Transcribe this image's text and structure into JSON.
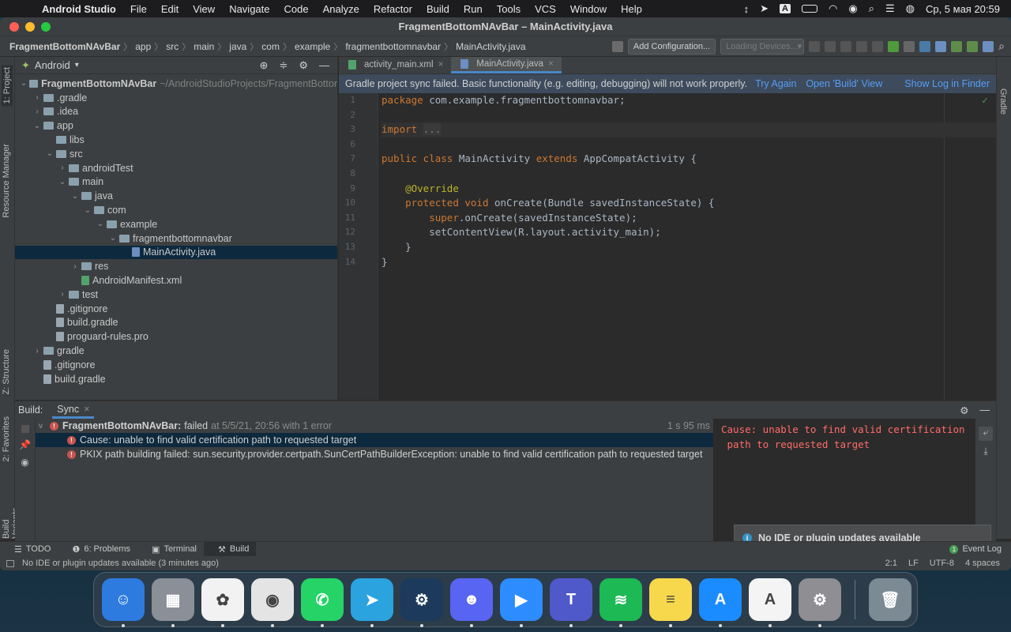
{
  "menubar": {
    "app": "Android Studio",
    "items": [
      "File",
      "Edit",
      "View",
      "Navigate",
      "Code",
      "Analyze",
      "Refactor",
      "Build",
      "Run",
      "Tools",
      "VCS",
      "Window",
      "Help"
    ],
    "datetime": "Ср, 5 мая  20:59"
  },
  "window": {
    "title": "FragmentBottomNAvBar – MainActivity.java"
  },
  "breadcrumb": [
    "FragmentBottomNAvBar",
    "app",
    "src",
    "main",
    "java",
    "com",
    "example",
    "fragmentbottomnavbar",
    "MainActivity.java"
  ],
  "toolbar": {
    "add_config": "Add Configuration...",
    "devices": "Loading Devices..."
  },
  "left_stripe": {
    "project": "1: Project",
    "resource": "Resource Manager",
    "structure": "Z: Structure",
    "favorites": "2: Favorites",
    "variants": "Build Variants"
  },
  "right_stripe": {
    "gradle": "Gradle"
  },
  "project": {
    "view": "Android",
    "tree": [
      {
        "label": "FragmentBottomNAvBar",
        "extra": "~/AndroidStudioProjects/FragmentBottor",
        "indent": 0,
        "arrow": "v",
        "icon": "folder",
        "bold": true
      },
      {
        "label": ".gradle",
        "indent": 1,
        "arrow": ">",
        "icon": "folder"
      },
      {
        "label": ".idea",
        "indent": 1,
        "arrow": ">",
        "icon": "folder"
      },
      {
        "label": "app",
        "indent": 1,
        "arrow": "v",
        "icon": "folder"
      },
      {
        "label": "libs",
        "indent": 2,
        "arrow": "",
        "icon": "folder"
      },
      {
        "label": "src",
        "indent": 2,
        "arrow": "v",
        "icon": "folder"
      },
      {
        "label": "androidTest",
        "indent": 3,
        "arrow": ">",
        "icon": "folder"
      },
      {
        "label": "main",
        "indent": 3,
        "arrow": "v",
        "icon": "folder"
      },
      {
        "label": "java",
        "indent": 4,
        "arrow": "v",
        "icon": "folder"
      },
      {
        "label": "com",
        "indent": 5,
        "arrow": "v",
        "icon": "folder"
      },
      {
        "label": "example",
        "indent": 6,
        "arrow": "v",
        "icon": "folder"
      },
      {
        "label": "fragmentbottomnavbar",
        "indent": 7,
        "arrow": "v",
        "icon": "folder"
      },
      {
        "label": "MainActivity.java",
        "indent": 8,
        "arrow": "",
        "icon": "java",
        "selected": true
      },
      {
        "label": "res",
        "indent": 4,
        "arrow": ">",
        "icon": "folder"
      },
      {
        "label": "AndroidManifest.xml",
        "indent": 4,
        "arrow": "",
        "icon": "xml"
      },
      {
        "label": "test",
        "indent": 3,
        "arrow": ">",
        "icon": "folder"
      },
      {
        "label": ".gitignore",
        "indent": 2,
        "arrow": "",
        "icon": "file"
      },
      {
        "label": "build.gradle",
        "indent": 2,
        "arrow": "",
        "icon": "file"
      },
      {
        "label": "proguard-rules.pro",
        "indent": 2,
        "arrow": "",
        "icon": "file"
      },
      {
        "label": "gradle",
        "indent": 1,
        "arrow": ">",
        "icon": "folder"
      },
      {
        "label": ".gitignore",
        "indent": 1,
        "arrow": "",
        "icon": "file"
      },
      {
        "label": "build.gradle",
        "indent": 1,
        "arrow": "",
        "icon": "file"
      }
    ]
  },
  "editor": {
    "tabs": [
      {
        "label": "activity_main.xml",
        "active": false
      },
      {
        "label": "MainActivity.java",
        "active": true
      }
    ],
    "banner": {
      "message": "Gradle project sync failed. Basic functionality (e.g. editing, debugging) will not work properly.",
      "try_again": "Try Again",
      "open_build": "Open 'Build' View",
      "show_log": "Show Log in Finder"
    },
    "line_numbers": [
      "1",
      "2",
      "3",
      "6",
      "7",
      "8",
      "9",
      "10",
      "11",
      "12",
      "13",
      "14"
    ],
    "code": [
      [
        {
          "t": "package ",
          "c": "kw"
        },
        {
          "t": "com.example.fragmentbottomnavbar;",
          "c": ""
        }
      ],
      [],
      [
        {
          "t": "import ",
          "c": "kw"
        },
        {
          "t": "...",
          "c": "fold"
        }
      ],
      [],
      [
        {
          "t": "public class ",
          "c": "kw"
        },
        {
          "t": "MainActivity ",
          "c": ""
        },
        {
          "t": "extends ",
          "c": "kw"
        },
        {
          "t": "AppCompatActivity {",
          "c": ""
        }
      ],
      [],
      [
        {
          "t": "    ",
          "c": ""
        },
        {
          "t": "@Override",
          "c": "ann"
        }
      ],
      [
        {
          "t": "    ",
          "c": ""
        },
        {
          "t": "protected void ",
          "c": "kw"
        },
        {
          "t": "onCreate(Bundle savedInstanceState) {",
          "c": ""
        }
      ],
      [
        {
          "t": "        ",
          "c": ""
        },
        {
          "t": "super",
          "c": "kw"
        },
        {
          "t": ".onCreate(savedInstanceState);",
          "c": ""
        }
      ],
      [
        {
          "t": "        setContentView(R.layout.",
          "c": ""
        },
        {
          "t": "activity_main",
          "c": ""
        },
        {
          "t": ");",
          "c": ""
        }
      ],
      [
        {
          "t": "    }",
          "c": ""
        }
      ],
      [
        {
          "t": "}",
          "c": ""
        }
      ]
    ]
  },
  "build": {
    "label": "Build:",
    "sync_tab": "Sync",
    "rows": [
      {
        "text": "FragmentBottomNAvBar:",
        "status": "failed",
        "detail": "at 5/5/21, 20:56 with 1 error",
        "time": "1 s 95 ms",
        "level": 0
      },
      {
        "text": "Cause: unable to find valid certification path to requested target",
        "level": 1,
        "selected": true
      },
      {
        "text": "PKIX path building failed: sun.security.provider.certpath.SunCertPathBuilderException: unable to find valid certification path to requested target",
        "level": 1
      }
    ],
    "console": [
      "Cause: unable to find valid certification",
      " path to requested target"
    ],
    "notification": "No IDE or plugin updates available"
  },
  "tool_tabs": [
    {
      "label": "TODO",
      "icon": "list-icon"
    },
    {
      "label": "6: Problems",
      "icon": "problems-icon"
    },
    {
      "label": "Terminal",
      "icon": "terminal-icon"
    },
    {
      "label": "Build",
      "icon": "build-hammer-icon",
      "active": true
    }
  ],
  "event_log": {
    "label": "Event Log",
    "count": "1"
  },
  "status": {
    "message": "No IDE or plugin updates available (3 minutes ago)",
    "position": "2:1",
    "line_sep": "LF",
    "encoding": "UTF-8",
    "indent": "4 spaces"
  },
  "dock": [
    {
      "name": "finder",
      "color": "#2e7be0",
      "glyph": "☺"
    },
    {
      "name": "launchpad",
      "color": "#8a8f98",
      "glyph": "▦"
    },
    {
      "name": "photos",
      "color": "#f2f2f2",
      "glyph": "✿"
    },
    {
      "name": "chrome",
      "color": "#e4e4e4",
      "glyph": "◉"
    },
    {
      "name": "whatsapp",
      "color": "#25d366",
      "glyph": "✆"
    },
    {
      "name": "telegram",
      "color": "#2aa3df",
      "glyph": "➤"
    },
    {
      "name": "steam",
      "color": "#1b3a5c",
      "glyph": "⚙"
    },
    {
      "name": "discord",
      "color": "#5865f2",
      "glyph": "☻"
    },
    {
      "name": "zoom",
      "color": "#2d8cff",
      "glyph": "▶"
    },
    {
      "name": "teams",
      "color": "#5059c9",
      "glyph": "T"
    },
    {
      "name": "spotify",
      "color": "#1db954",
      "glyph": "≋"
    },
    {
      "name": "notes",
      "color": "#f7d84c",
      "glyph": "≡"
    },
    {
      "name": "app-store",
      "color": "#1a8cff",
      "glyph": "A"
    },
    {
      "name": "android-studio",
      "color": "#f4f4f4",
      "glyph": "A"
    },
    {
      "name": "system-preferences",
      "color": "#8e8e93",
      "glyph": "⚙"
    },
    {
      "name": "trash",
      "color": "#7c8a94",
      "glyph": "🗑"
    }
  ]
}
